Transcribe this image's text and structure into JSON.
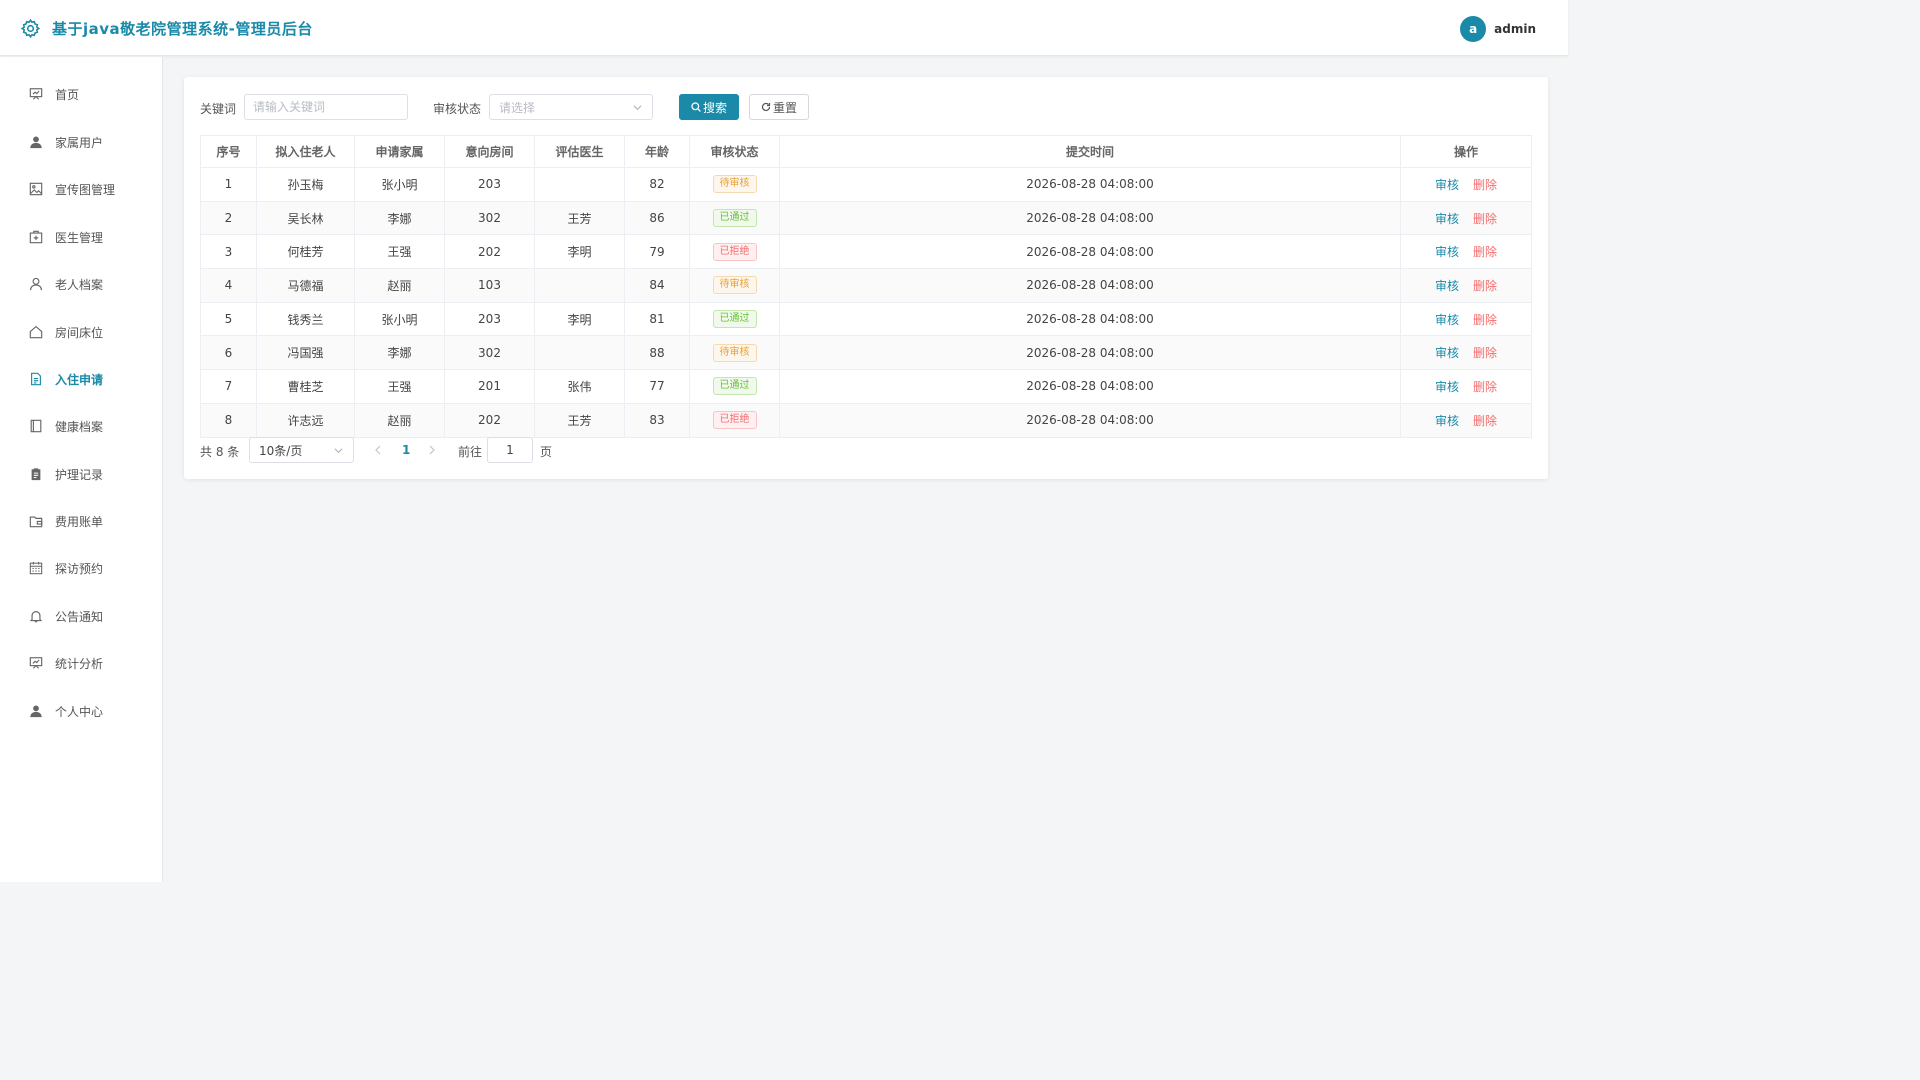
{
  "header": {
    "title": "基于java敬老院管理系统-管理员后台",
    "avatar_letter": "a",
    "username": "admin",
    "accent_color": "#1a8aa8"
  },
  "sidebar": {
    "items": [
      {
        "label": "首页",
        "icon": "dashboard-icon"
      },
      {
        "label": "家属用户",
        "icon": "user-icon"
      },
      {
        "label": "宣传图管理",
        "icon": "picture-icon"
      },
      {
        "label": "医生管理",
        "icon": "first-aid-kit-icon"
      },
      {
        "label": "老人档案",
        "icon": "person-outline-icon"
      },
      {
        "label": "房间床位",
        "icon": "house-icon"
      },
      {
        "label": "入住申请",
        "icon": "document-icon",
        "active": true
      },
      {
        "label": "健康档案",
        "icon": "notebook-icon"
      },
      {
        "label": "护理记录",
        "icon": "clipboard-icon"
      },
      {
        "label": "费用账单",
        "icon": "wallet-icon"
      },
      {
        "label": "探访预约",
        "icon": "calendar-icon"
      },
      {
        "label": "公告通知",
        "icon": "bell-icon"
      },
      {
        "label": "统计分析",
        "icon": "chart-board-icon"
      },
      {
        "label": "个人中心",
        "icon": "user-icon"
      }
    ]
  },
  "filters": {
    "keyword_label": "关键词",
    "keyword_placeholder": "请输入关键词",
    "keyword_value": "",
    "status_label": "审核状态",
    "status_placeholder": "请选择",
    "search_label": "搜索",
    "reset_label": "重置"
  },
  "table": {
    "columns": [
      "序号",
      "拟入住老人",
      "申请家属",
      "意向房间",
      "评估医生",
      "年龄",
      "审核状态",
      "提交时间",
      "操作"
    ],
    "rows": [
      {
        "no": "1",
        "elder": "孙玉梅",
        "family": "张小明",
        "room": "203",
        "doctor": "",
        "age": "82",
        "status": "待审核",
        "status_type": "pending",
        "time": "2026-08-28 04:08:00"
      },
      {
        "no": "2",
        "elder": "吴长林",
        "family": "李娜",
        "room": "302",
        "doctor": "王芳",
        "age": "86",
        "status": "已通过",
        "status_type": "passed",
        "time": "2026-08-28 04:08:00"
      },
      {
        "no": "3",
        "elder": "何桂芳",
        "family": "王强",
        "room": "202",
        "doctor": "李明",
        "age": "79",
        "status": "已拒绝",
        "status_type": "rejected",
        "time": "2026-08-28 04:08:00"
      },
      {
        "no": "4",
        "elder": "马德福",
        "family": "赵丽",
        "room": "103",
        "doctor": "",
        "age": "84",
        "status": "待审核",
        "status_type": "pending",
        "time": "2026-08-28 04:08:00"
      },
      {
        "no": "5",
        "elder": "钱秀兰",
        "family": "张小明",
        "room": "203",
        "doctor": "李明",
        "age": "81",
        "status": "已通过",
        "status_type": "passed",
        "time": "2026-08-28 04:08:00"
      },
      {
        "no": "6",
        "elder": "冯国强",
        "family": "李娜",
        "room": "302",
        "doctor": "",
        "age": "88",
        "status": "待审核",
        "status_type": "pending",
        "time": "2026-08-28 04:08:00"
      },
      {
        "no": "7",
        "elder": "曹桂芝",
        "family": "王强",
        "room": "201",
        "doctor": "张伟",
        "age": "77",
        "status": "已通过",
        "status_type": "passed",
        "time": "2026-08-28 04:08:00"
      },
      {
        "no": "8",
        "elder": "许志远",
        "family": "赵丽",
        "room": "202",
        "doctor": "王芳",
        "age": "83",
        "status": "已拒绝",
        "status_type": "rejected",
        "time": "2026-08-28 04:08:00"
      }
    ],
    "actions": {
      "audit": "审核",
      "delete": "删除"
    }
  },
  "pagination": {
    "total_text": "共 8 条",
    "page_size": "10条/页",
    "current_page": "1",
    "goto_label": "前往",
    "goto_value": "1",
    "page_word": "页"
  },
  "status_colors": {
    "pending": "#e6a23c",
    "passed": "#67c23a",
    "rejected": "#f56c6c"
  }
}
